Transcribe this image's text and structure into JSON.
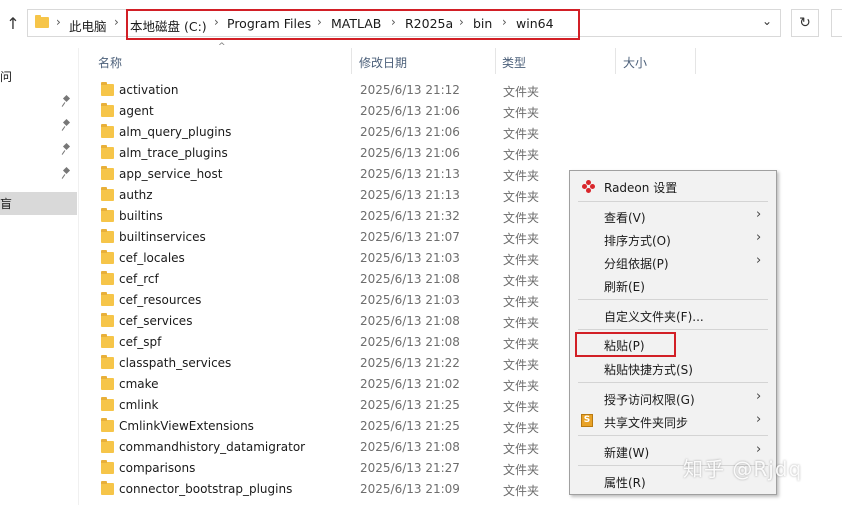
{
  "address_bar": {
    "breadcrumbs": [
      "此电脑",
      "本地磁盘 (C:)",
      "Program Files",
      "MATLAB",
      "R2025a",
      "bin",
      "win64"
    ],
    "separator": "›",
    "dropdown_glyph": "⌄",
    "refresh_glyph": "↻",
    "up_glyph": "↑"
  },
  "nav_pane": {
    "fragments": [
      "问",
      "盲"
    ]
  },
  "columns": {
    "name": "名称",
    "date": "修改日期",
    "type": "类型",
    "size": "大小"
  },
  "files": [
    {
      "name": "activation",
      "date": "2025/6/13 21:12",
      "type": "文件夹"
    },
    {
      "name": "agent",
      "date": "2025/6/13 21:06",
      "type": "文件夹"
    },
    {
      "name": "alm_query_plugins",
      "date": "2025/6/13 21:06",
      "type": "文件夹"
    },
    {
      "name": "alm_trace_plugins",
      "date": "2025/6/13 21:06",
      "type": "文件夹"
    },
    {
      "name": "app_service_host",
      "date": "2025/6/13 21:13",
      "type": "文件夹"
    },
    {
      "name": "authz",
      "date": "2025/6/13 21:13",
      "type": "文件夹"
    },
    {
      "name": "builtins",
      "date": "2025/6/13 21:32",
      "type": "文件夹"
    },
    {
      "name": "builtinservices",
      "date": "2025/6/13 21:07",
      "type": "文件夹"
    },
    {
      "name": "cef_locales",
      "date": "2025/6/13 21:03",
      "type": "文件夹"
    },
    {
      "name": "cef_rcf",
      "date": "2025/6/13 21:08",
      "type": "文件夹"
    },
    {
      "name": "cef_resources",
      "date": "2025/6/13 21:03",
      "type": "文件夹"
    },
    {
      "name": "cef_services",
      "date": "2025/6/13 21:08",
      "type": "文件夹"
    },
    {
      "name": "cef_spf",
      "date": "2025/6/13 21:08",
      "type": "文件夹"
    },
    {
      "name": "classpath_services",
      "date": "2025/6/13 21:22",
      "type": "文件夹"
    },
    {
      "name": "cmake",
      "date": "2025/6/13 21:02",
      "type": "文件夹"
    },
    {
      "name": "cmlink",
      "date": "2025/6/13 21:25",
      "type": "文件夹"
    },
    {
      "name": "CmlinkViewExtensions",
      "date": "2025/6/13 21:25",
      "type": "文件夹"
    },
    {
      "name": "commandhistory_datamigrator",
      "date": "2025/6/13 21:08",
      "type": "文件夹"
    },
    {
      "name": "comparisons",
      "date": "2025/6/13 21:27",
      "type": "文件夹"
    },
    {
      "name": "connector_bootstrap_plugins",
      "date": "2025/6/13 21:09",
      "type": "文件夹"
    }
  ],
  "context_menu": {
    "radeon": "Radeon 设置",
    "view": "查看(V)",
    "sort": "排序方式(O)",
    "group": "分组依据(P)",
    "refresh": "刷新(E)",
    "customize": "自定义文件夹(F)...",
    "paste": "粘贴(P)",
    "paste_shortcut": "粘贴快捷方式(S)",
    "grant_access": "授予访问权限(G)",
    "share_sync": "共享文件夹同步",
    "new": "新建(W)",
    "properties": "属性(R)",
    "submenu_arrow": "›",
    "share_icon_letter": "S"
  },
  "watermark": "知乎 @Rjdq",
  "colors": {
    "highlight_red": "#d21f26",
    "folder_yellow": "#f6c549",
    "menu_bg": "#f2f2f2",
    "radeon_red": "#d9262b"
  }
}
